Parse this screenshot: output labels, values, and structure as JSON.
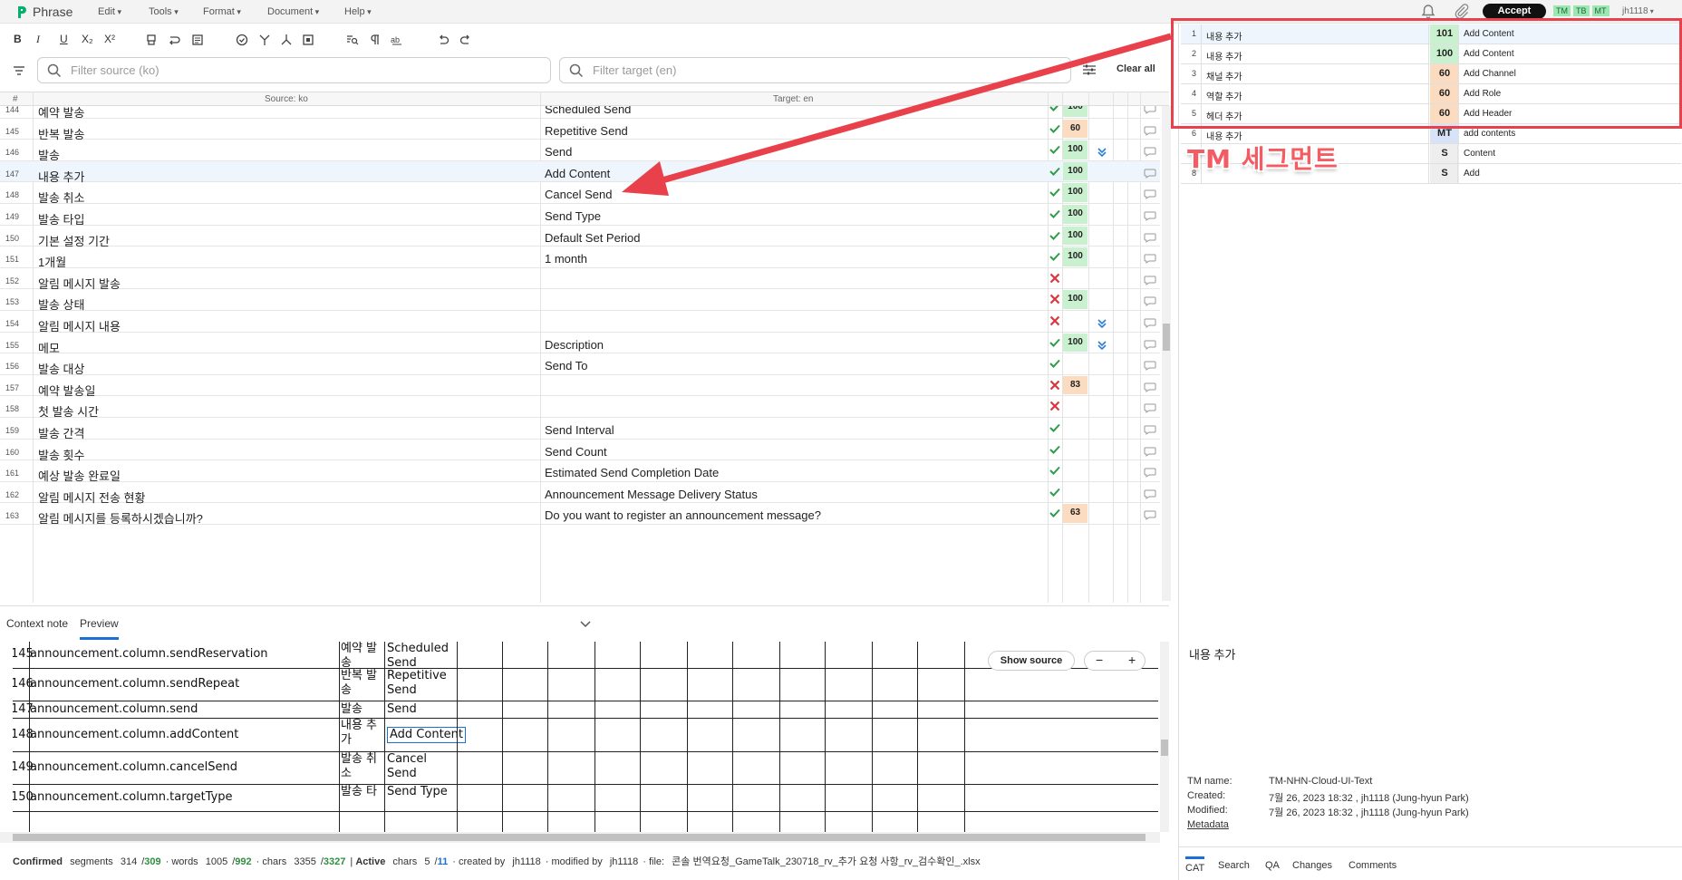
{
  "app": {
    "name": "Phrase",
    "menus": [
      "Edit",
      "Tools",
      "Format",
      "Document",
      "Help"
    ]
  },
  "header_right": {
    "accept": "Accept",
    "sources": [
      "TM",
      "TB",
      "MT"
    ],
    "user": "jh1118"
  },
  "toolbar": {
    "bold": "B",
    "italic": "I",
    "underline": "U",
    "subscript": "X₂",
    "superscript": "X²"
  },
  "filters": {
    "source_placeholder": "Filter source (ko)",
    "target_placeholder": "Filter target (en)",
    "clear_all": "Clear all"
  },
  "grid": {
    "columns": {
      "num": "#",
      "source": "Source: ko",
      "target": "Target: en"
    },
    "rows": [
      {
        "num": "144",
        "source": "예약 발송",
        "target": "Scheduled Send",
        "status": "ok",
        "score": "100",
        "score_color": "green",
        "arrow": false
      },
      {
        "num": "145",
        "source": "반복 발송",
        "target": "Repetitive Send",
        "status": "ok",
        "score": "60",
        "score_color": "orange",
        "arrow": false
      },
      {
        "num": "146",
        "source": "발송",
        "target": "Send",
        "status": "ok",
        "score": "100",
        "score_color": "green",
        "arrow": true
      },
      {
        "num": "147",
        "source": "내용 추가",
        "target": "Add Content",
        "status": "ok",
        "score": "100",
        "score_color": "green",
        "arrow": false,
        "active": true
      },
      {
        "num": "148",
        "source": "발송 취소",
        "target": "Cancel Send",
        "status": "ok",
        "score": "100",
        "score_color": "green",
        "arrow": false
      },
      {
        "num": "149",
        "source": "발송 타입",
        "target": "Send Type",
        "status": "ok",
        "score": "100",
        "score_color": "green",
        "arrow": false
      },
      {
        "num": "150",
        "source": "기본 설정 기간",
        "target": "Default Set Period",
        "status": "ok",
        "score": "100",
        "score_color": "green",
        "arrow": false
      },
      {
        "num": "151",
        "source": "1개월",
        "target": "1 month",
        "status": "ok",
        "score": "100",
        "score_color": "green",
        "arrow": false
      },
      {
        "num": "152",
        "source": "알림 메시지 발송",
        "target": "",
        "status": "x",
        "score": "",
        "score_color": "",
        "arrow": false
      },
      {
        "num": "153",
        "source": "발송 상태",
        "target": "",
        "status": "x",
        "score": "100",
        "score_color": "green",
        "arrow": false
      },
      {
        "num": "154",
        "source": "알림 메시지 내용",
        "target": "",
        "status": "x",
        "score": "",
        "score_color": "",
        "arrow": true
      },
      {
        "num": "155",
        "source": "메모",
        "target": "Description",
        "status": "ok",
        "score": "100",
        "score_color": "green",
        "arrow": true
      },
      {
        "num": "156",
        "source": "발송 대상",
        "target": "Send To",
        "status": "ok",
        "score": "",
        "score_color": "",
        "arrow": false
      },
      {
        "num": "157",
        "source": "예약 발송일",
        "target": "",
        "status": "x",
        "score": "83",
        "score_color": "orange",
        "arrow": false
      },
      {
        "num": "158",
        "source": "첫 발송 시간",
        "target": "",
        "status": "x",
        "score": "",
        "score_color": "",
        "arrow": false
      },
      {
        "num": "159",
        "source": "발송 간격",
        "target": "Send Interval",
        "status": "ok",
        "score": "",
        "score_color": "",
        "arrow": false
      },
      {
        "num": "160",
        "source": "발송 횟수",
        "target": "Send Count",
        "status": "ok",
        "score": "",
        "score_color": "",
        "arrow": false
      },
      {
        "num": "161",
        "source": "예상 발송 완료일",
        "target": "Estimated Send Completion Date",
        "status": "ok",
        "score": "",
        "score_color": "",
        "arrow": false
      },
      {
        "num": "162",
        "source": "알림 메시지 전송 현황",
        "target": "Announcement Message Delivery Status",
        "status": "ok",
        "score": "",
        "score_color": "",
        "arrow": false
      },
      {
        "num": "163",
        "source": "알림 메시지를 등록하시겠습니까?",
        "target": "Do you want to register an announcement message?",
        "status": "ok",
        "score": "63",
        "score_color": "orange",
        "arrow": false
      }
    ]
  },
  "bottom_panel": {
    "tabs": [
      "Context note",
      "Preview"
    ],
    "show_source": "Show source",
    "zoom_minus": "−",
    "zoom_plus": "+",
    "preview_rows": [
      {
        "num": "145",
        "key": "announcement.column.sendReservation",
        "ko": "예약 발 송",
        "en": "Scheduled Send"
      },
      {
        "num": "146",
        "key": "announcement.column.sendRepeat",
        "ko": "반복 발 송",
        "en": "Repetitive Send"
      },
      {
        "num": "147",
        "key": "announcement.column.send",
        "ko": "발송",
        "en": "Send"
      },
      {
        "num": "148",
        "key": "announcement.column.addContent",
        "ko": "내용 추 가",
        "en": "Add Content"
      },
      {
        "num": "149",
        "key": "announcement.column.cancelSend",
        "ko": "발송 취 소",
        "en": "Cancel Send"
      },
      {
        "num": "150",
        "key": "announcement.column.targetType",
        "ko": "발송 타",
        "en": "Send Type"
      }
    ]
  },
  "statusbar": {
    "confirmed": "Confirmed",
    "segments_label": "segments",
    "segments_done": "314",
    "segments_total": "309",
    "words_label": "words",
    "words_done": "1005",
    "words_total": "992",
    "chars_label": "chars",
    "chars_done": "3355",
    "chars_total": "3327",
    "active": "Active",
    "active_chars_label": "chars",
    "active_chars": "5",
    "active_chars_total": "11",
    "created_by": "created by",
    "creator": "jh1118",
    "modified_by": "modified by",
    "modifier": "jh1118",
    "file_label": "file:",
    "file_name": "콘솔 번역요청_GameTalk_230718_rv_추가 요청 사항_rv_검수확인_.xlsx"
  },
  "tm_panel": {
    "matches": [
      {
        "num": "1",
        "source": "내용 추가",
        "score": "101",
        "type": "green",
        "target": "Add Content"
      },
      {
        "num": "2",
        "source": "내용 추가",
        "score": "100",
        "type": "green",
        "target": "Add Content"
      },
      {
        "num": "3",
        "source": "채널 추가",
        "score": "60",
        "type": "orange",
        "target": "Add Channel"
      },
      {
        "num": "4",
        "source": "역할 추가",
        "score": "60",
        "type": "orange",
        "target": "Add Role"
      },
      {
        "num": "5",
        "source": "헤더 추가",
        "score": "60",
        "type": "orange",
        "target": "Add Header"
      },
      {
        "num": "6",
        "source": "내용 추가",
        "score": "MT",
        "type": "mt",
        "target": "add contents"
      },
      {
        "num": "7",
        "source": "",
        "score": "S",
        "type": "s",
        "target": "Content"
      },
      {
        "num": "8",
        "source": "",
        "score": "S",
        "type": "s",
        "target": "Add"
      }
    ],
    "annotation_label": "TM 세그먼트",
    "source_preview": "내용 추가",
    "meta": [
      {
        "key": "TM name:",
        "value": "TM-NHN-Cloud-UI-Text"
      },
      {
        "key": "Created:",
        "value": "7월 26, 2023 18:32 , jh1118 (Jung-hyun Park)"
      },
      {
        "key": "Modified:",
        "value": "7월 26, 2023 18:32 , jh1118 (Jung-hyun Park)"
      }
    ],
    "metadata_link": "Metadata",
    "tabs": [
      "CAT",
      "Search",
      "QA",
      "Changes",
      "Comments"
    ]
  }
}
